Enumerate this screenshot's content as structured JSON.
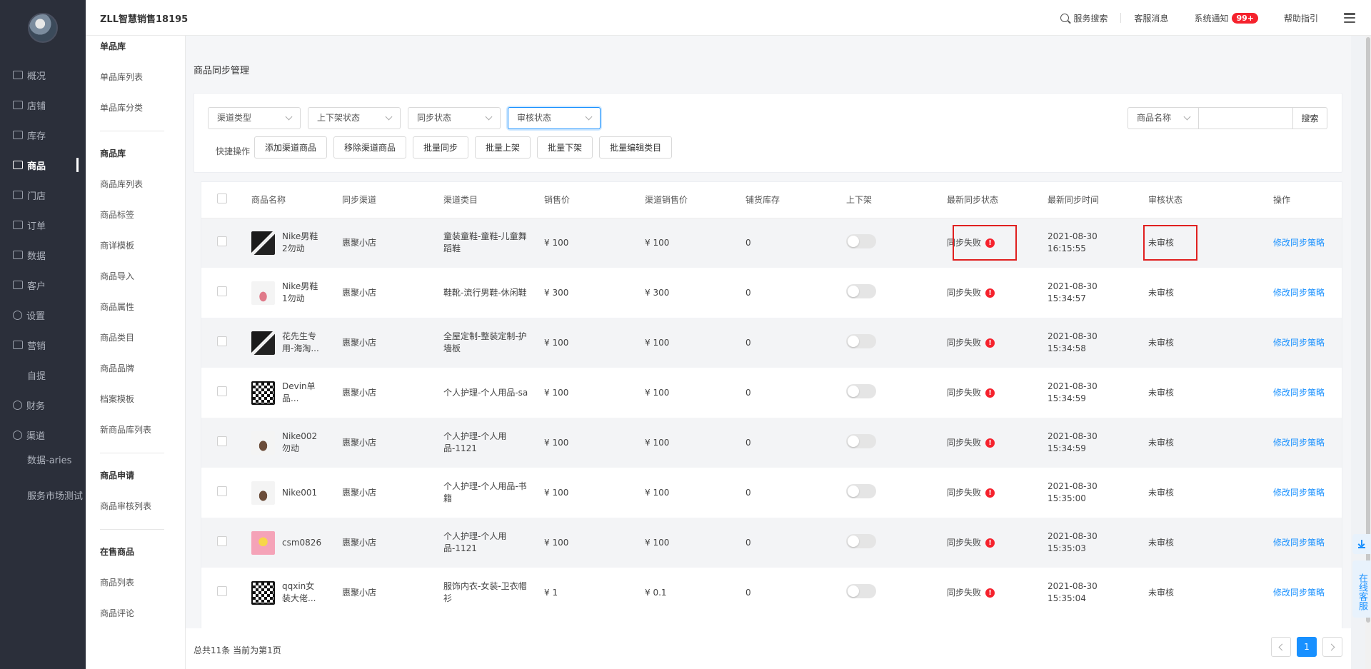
{
  "nav": [
    {
      "label": "概况",
      "icon": "dashboard-icon"
    },
    {
      "label": "店铺",
      "icon": "store-icon"
    },
    {
      "label": "库存",
      "icon": "inventory-icon"
    },
    {
      "label": "商品",
      "icon": "goods-icon"
    },
    {
      "label": "门店",
      "icon": "shop-icon"
    },
    {
      "label": "订单",
      "icon": "order-icon"
    },
    {
      "label": "数据",
      "icon": "data-icon"
    },
    {
      "label": "客户",
      "icon": "customer-icon"
    },
    {
      "label": "设置",
      "icon": "settings-icon"
    },
    {
      "label": "营销",
      "icon": "marketing-icon"
    },
    {
      "label": "自提",
      "icon": ""
    },
    {
      "label": "财务",
      "icon": "finance-icon"
    },
    {
      "label": "渠道",
      "icon": "channel-icon"
    },
    {
      "label": "数据-aries",
      "icon": ""
    },
    {
      "label": "服务市场测试",
      "icon": ""
    }
  ],
  "subnav": {
    "g1": {
      "title": "单品库",
      "items": [
        "单品库列表",
        "单品库分类"
      ]
    },
    "g2": {
      "title": "商品库",
      "items": [
        "商品库列表",
        "商品标签",
        "商详模板",
        "商品导入",
        "商品属性",
        "商品类目",
        "商品品牌",
        "档案模板",
        "新商品库列表"
      ]
    },
    "g3": {
      "title": "商品申请",
      "items": [
        "商品审核列表"
      ]
    },
    "g4": {
      "title": "在售商品",
      "items": [
        "商品列表",
        "商品评论"
      ]
    }
  },
  "header": {
    "store_title": "ZLL智慧销售18195",
    "search": "服务搜索",
    "cs_msg": "客服消息",
    "notice": "系统通知",
    "notice_badge": "99+",
    "help": "帮助指引"
  },
  "page": {
    "title": "商品同步管理"
  },
  "filters": {
    "channel_type": "渠道类型",
    "shelf_status": "上下架状态",
    "sync_status": "同步状态",
    "audit_status": "审核状态",
    "search_field": "商品名称",
    "search_value": "",
    "search_btn": "搜索"
  },
  "quick": {
    "label": "快捷操作",
    "buttons": [
      "添加渠道商品",
      "移除渠道商品",
      "批量同步",
      "批量上架",
      "批量下架",
      "批量编辑类目"
    ]
  },
  "table": {
    "headers": [
      "商品名称",
      "同步渠道",
      "渠道类目",
      "销售价",
      "渠道销售价",
      "铺货库存",
      "上下架",
      "最新同步状态",
      "最新同步时间",
      "审核状态",
      "操作"
    ],
    "rows": [
      {
        "thumb": "t-dark",
        "name": "Nike男鞋2勿动",
        "channel": "惠聚小店",
        "category": "童装童鞋-童鞋-儿童舞蹈鞋",
        "price": "¥ 100",
        "channel_price": "¥ 100",
        "stock": "0",
        "sync_status": "同步失败",
        "sync_date": "2021-08-30",
        "sync_time": "16:15:55",
        "audit": "未审核",
        "action": "修改同步策略"
      },
      {
        "thumb": "t-shoe",
        "name": "Nike男鞋1勿动",
        "channel": "惠聚小店",
        "category": "鞋靴-流行男鞋-休闲鞋",
        "price": "¥ 300",
        "channel_price": "¥ 300",
        "stock": "0",
        "sync_status": "同步失败",
        "sync_date": "2021-08-30",
        "sync_time": "15:34:57",
        "audit": "未审核",
        "action": "修改同步策略"
      },
      {
        "thumb": "t-dark",
        "name": "花先生专用-海淘...",
        "channel": "惠聚小店",
        "category": "全屋定制-整装定制-护墙板",
        "price": "¥ 100",
        "channel_price": "¥ 100",
        "stock": "0",
        "sync_status": "同步失败",
        "sync_date": "2021-08-30",
        "sync_time": "15:34:58",
        "audit": "未审核",
        "action": "修改同步策略"
      },
      {
        "thumb": "t-qr",
        "name": "Devin单品...",
        "channel": "惠聚小店",
        "category": "个人护理-个人用品-sa",
        "price": "¥ 100",
        "channel_price": "¥ 100",
        "stock": "0",
        "sync_status": "同步失败",
        "sync_date": "2021-08-30",
        "sync_time": "15:34:59",
        "audit": "未审核",
        "action": "修改同步策略"
      },
      {
        "thumb": "t-shoe2",
        "name": "Nike002勿动",
        "channel": "惠聚小店",
        "category": "个人护理-个人用品-1121",
        "price": "¥ 100",
        "channel_price": "¥ 100",
        "stock": "0",
        "sync_status": "同步失败",
        "sync_date": "2021-08-30",
        "sync_time": "15:34:59",
        "audit": "未审核",
        "action": "修改同步策略"
      },
      {
        "thumb": "t-shoe2",
        "name": "Nike001",
        "channel": "惠聚小店",
        "category": "个人护理-个人用品-书籍",
        "price": "¥ 100",
        "channel_price": "¥ 100",
        "stock": "0",
        "sync_status": "同步失败",
        "sync_date": "2021-08-30",
        "sync_time": "15:35:00",
        "audit": "未审核",
        "action": "修改同步策略"
      },
      {
        "thumb": "t-pink",
        "name": "csm0826",
        "channel": "惠聚小店",
        "category": "个人护理-个人用品-1121",
        "price": "¥ 100",
        "channel_price": "¥ 100",
        "stock": "0",
        "sync_status": "同步失败",
        "sync_date": "2021-08-30",
        "sync_time": "15:35:03",
        "audit": "未审核",
        "action": "修改同步策略"
      },
      {
        "thumb": "t-qr",
        "name": "qqxin女装大佬...",
        "channel": "惠聚小店",
        "category": "服饰内衣-女装-卫衣帽衫",
        "price": "¥ 1",
        "channel_price": "¥ 0.1",
        "stock": "0",
        "sync_status": "同步失败",
        "sync_date": "2021-08-30",
        "sync_time": "15:35:04",
        "audit": "未审核",
        "action": "修改同步策略"
      }
    ]
  },
  "footer": {
    "total": "总共11条 当前为第1页",
    "current_page": "1"
  },
  "float": {
    "customer_service": "在线客服"
  },
  "colors": {
    "primary": "#1890ff",
    "danger": "#f5222d",
    "sidebar": "#2b2f3a"
  }
}
